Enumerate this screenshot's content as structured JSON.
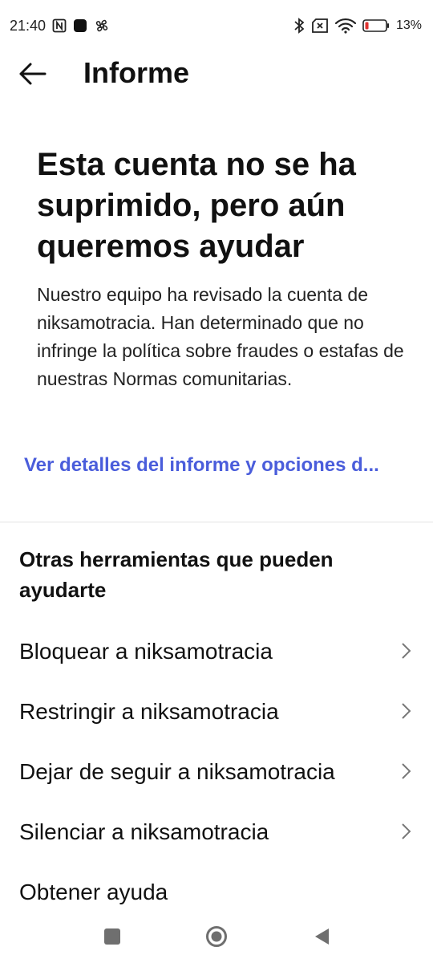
{
  "status_bar": {
    "time": "21:40",
    "battery_percent": "13%",
    "battery_level": 0.13,
    "icons_left": [
      "nfc-icon",
      "app-square-icon",
      "fan-icon"
    ],
    "icons_right": [
      "bluetooth-icon",
      "sim-off-icon",
      "wifi-icon",
      "battery-icon"
    ]
  },
  "header": {
    "title": "Informe",
    "back_icon": "arrow-left-icon"
  },
  "result": {
    "headline": "Esta cuenta no se ha suprimido, pero aún queremos ayudar",
    "body": "Nuestro equipo ha revisado la cuenta de niksamotracia. Han determinado que no infringe la política sobre fraudes o estafas de nuestras Normas comunitarias.",
    "details_link": "Ver detalles del informe y opciones d..."
  },
  "tools": {
    "title": "Otras herramientas que pueden ayudarte",
    "items": [
      {
        "label": "Bloquear a niksamotracia"
      },
      {
        "label": "Restringir a niksamotracia"
      },
      {
        "label": "Dejar de seguir a niksamotracia"
      },
      {
        "label": "Silenciar a niksamotracia"
      },
      {
        "label": "Obtener ayuda"
      }
    ]
  },
  "colors": {
    "accent_link": "#4a5ddb",
    "battery_low": "#e0322f"
  }
}
